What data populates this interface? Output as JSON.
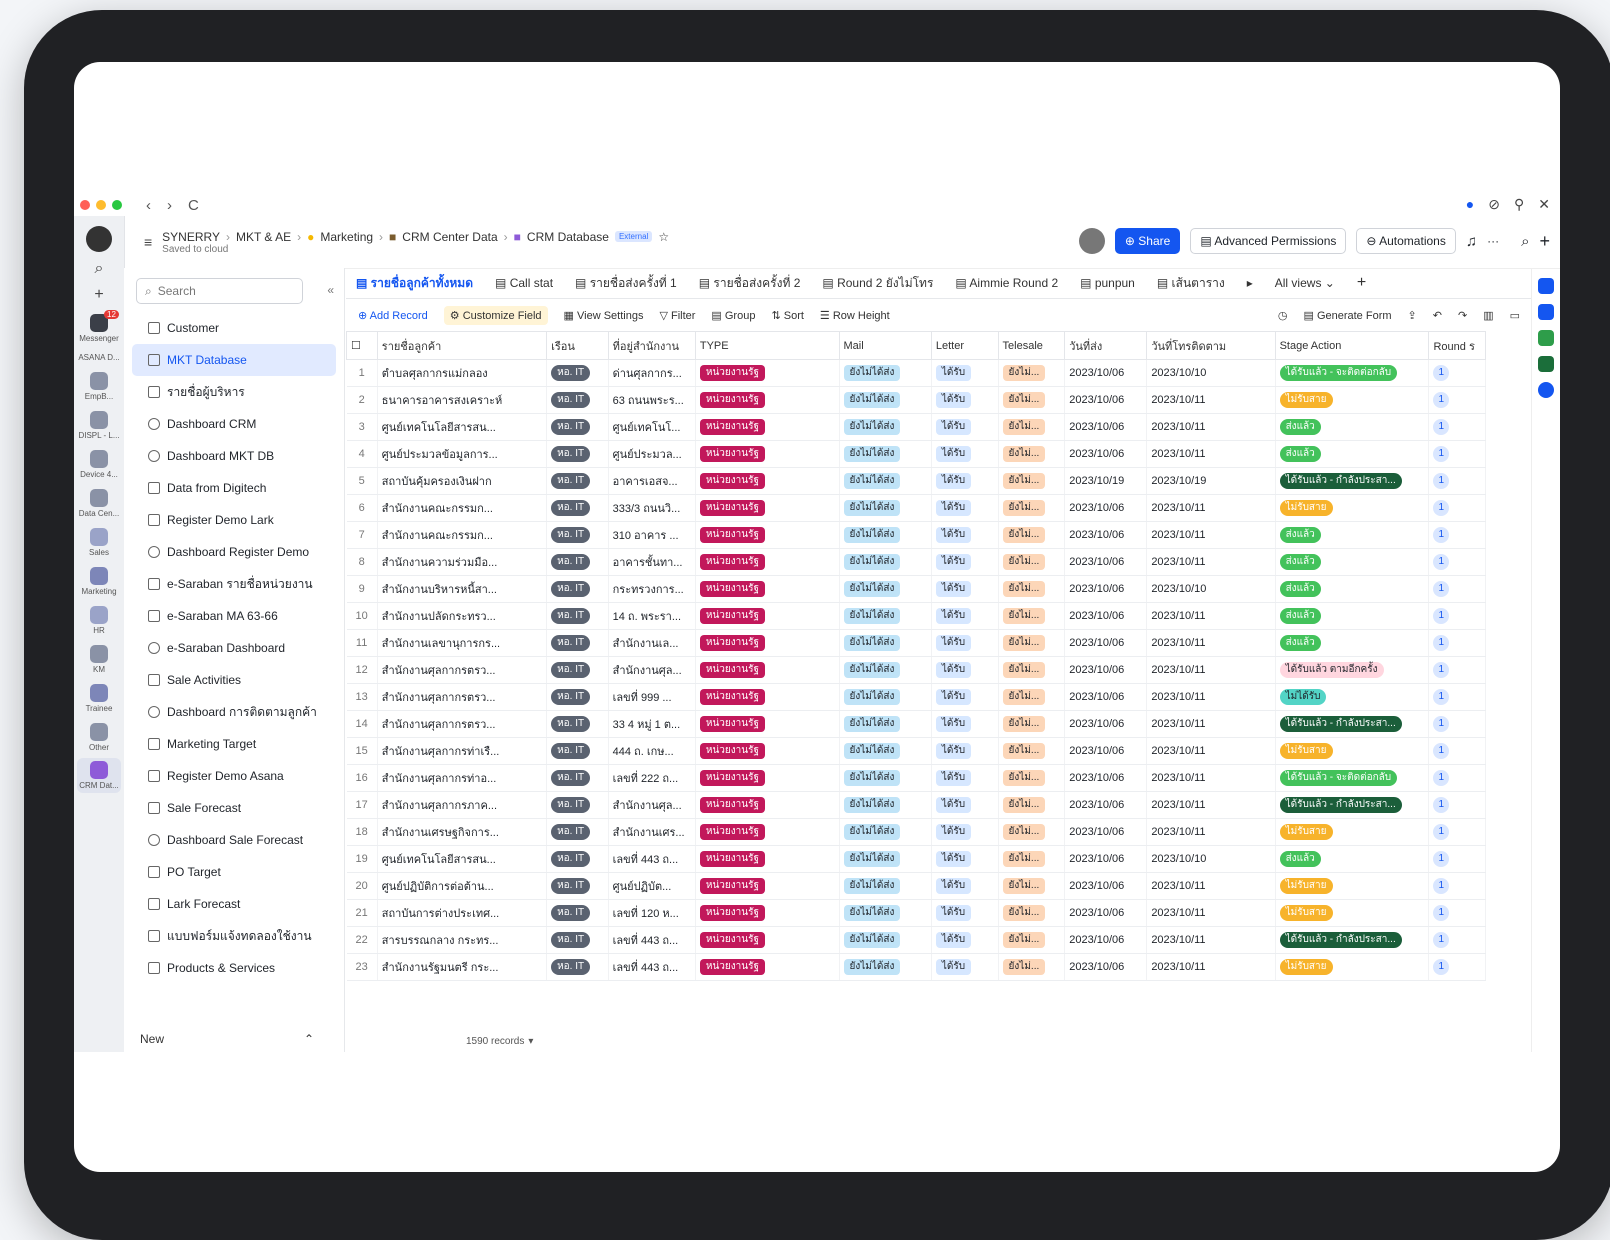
{
  "window": {
    "nav_back": "‹",
    "nav_forward": "›",
    "nav_reload": "C",
    "controls": [
      "●",
      "⊘",
      "⚲",
      "✕"
    ]
  },
  "rail": {
    "messenger_badge": "12",
    "items": [
      "Messenger",
      "ASANA D...",
      "EmpB...",
      "DISPL - L...",
      "Device 4...",
      "Data Cen...",
      "Sales",
      "Marketing",
      "HR",
      "KM",
      "Trainee",
      "Other",
      "CRM Dat..."
    ]
  },
  "header": {
    "crumbs": [
      "SYNERRY",
      "MKT & AE",
      "Marketing",
      "CRM Center Data",
      "CRM Database"
    ],
    "external": "External",
    "saved": "Saved to cloud",
    "share": "Share",
    "advanced_permissions": "Advanced Permissions",
    "automations": "Automations"
  },
  "sidebar": {
    "search_placeholder": "Search",
    "items": [
      {
        "label": "Customer",
        "type": "table"
      },
      {
        "label": "MKT Database",
        "type": "table",
        "active": true
      },
      {
        "label": "รายชื่อผู้บริหาร",
        "type": "table"
      },
      {
        "label": "Dashboard CRM",
        "type": "dash"
      },
      {
        "label": "Dashboard MKT DB",
        "type": "dash"
      },
      {
        "label": "Data from Digitech",
        "type": "table"
      },
      {
        "label": "Register Demo Lark",
        "type": "table"
      },
      {
        "label": "Dashboard Register Demo",
        "type": "dash"
      },
      {
        "label": "e-Saraban รายชื่อหน่วยงาน",
        "type": "table"
      },
      {
        "label": "e-Saraban MA 63-66",
        "type": "table"
      },
      {
        "label": "e-Saraban Dashboard",
        "type": "dash"
      },
      {
        "label": "Sale Activities",
        "type": "table"
      },
      {
        "label": "Dashboard การติดตามลูกค้า",
        "type": "dash"
      },
      {
        "label": "Marketing Target",
        "type": "table"
      },
      {
        "label": "Register Demo Asana",
        "type": "table"
      },
      {
        "label": "Sale Forecast",
        "type": "table"
      },
      {
        "label": "Dashboard Sale Forecast",
        "type": "dash"
      },
      {
        "label": "PO Target",
        "type": "table"
      },
      {
        "label": "Lark Forecast",
        "type": "table"
      },
      {
        "label": "แบบฟอร์มแจ้งทดลองใช้งาน",
        "type": "table"
      },
      {
        "label": "Products & Services",
        "type": "table"
      }
    ],
    "new_label": "New"
  },
  "views": {
    "tabs": [
      "รายชื่อลูกค้าทั้งหมด",
      "Call stat",
      "รายชื่อส่งครั้งที่ 1",
      "รายชื่อส่งครั้งที่ 2",
      "Round 2 ยังไม่โทร",
      "Aimmie Round 2",
      "punpun",
      "เส้นตาราง"
    ],
    "all_views": "All views"
  },
  "toolbar": {
    "add_record": "Add Record",
    "customize_field": "Customize Field",
    "view_settings": "View Settings",
    "filter": "Filter",
    "group": "Group",
    "sort": "Sort",
    "row_height": "Row Height",
    "generate_form": "Generate Form"
  },
  "table": {
    "columns": [
      "",
      "รายชื่อลูกค้า",
      "เรือน",
      "ที่อยู่สำนักงาน",
      "TYPE",
      "Mail",
      "Letter",
      "Telesale",
      "วันที่ส่ง",
      "วันที่โทรติดตาม",
      "Stage Action",
      "Round ร"
    ],
    "rows": [
      {
        "n": "1",
        "name": "ตำบลศุลกากรแม่กลอง",
        "ru": "หอ. IT",
        "addr": "ด่านศุลกากร...",
        "type": "หน่วยงานรัฐ",
        "mail": "ยังไม่ได้ส่ง",
        "letter": "ได้รับ",
        "tele": "ยังไม่...",
        "sent": "2023/10/06",
        "follow": "2023/10/10",
        "stage": "ได้รับแล้ว - จะติดต่อกลับ",
        "stage_c": "g1",
        "round": "1"
      },
      {
        "n": "2",
        "name": "ธนาคารอาคารสงเคราะห์",
        "ru": "หอ. IT",
        "addr": "63 ถนนพระร...",
        "type": "หน่วยงานรัฐ",
        "mail": "ยังไม่ได้ส่ง",
        "letter": "ได้รับ",
        "tele": "ยังไม่...",
        "sent": "2023/10/06",
        "follow": "2023/10/11",
        "stage": "ไม่รับสาย",
        "stage_c": "or",
        "round": "1"
      },
      {
        "n": "3",
        "name": "ศูนย์เทคโนโลยีสารสน...",
        "ru": "หอ. IT",
        "addr": "ศูนย์เทคโนโ...",
        "type": "หน่วยงานรัฐ",
        "mail": "ยังไม่ได้ส่ง",
        "letter": "ได้รับ",
        "tele": "ยังไม่...",
        "sent": "2023/10/06",
        "follow": "2023/10/11",
        "stage": "ส่งแล้ว",
        "stage_c": "g1",
        "round": "1"
      },
      {
        "n": "4",
        "name": "ศูนย์ประมวลข้อมูลการ...",
        "ru": "หอ. IT",
        "addr": "ศูนย์ประมวล...",
        "type": "หน่วยงานรัฐ",
        "mail": "ยังไม่ได้ส่ง",
        "letter": "ได้รับ",
        "tele": "ยังไม่...",
        "sent": "2023/10/06",
        "follow": "2023/10/11",
        "stage": "ส่งแล้ว",
        "stage_c": "g1",
        "round": "1"
      },
      {
        "n": "5",
        "name": "สถาบันคุ้มครองเงินฝาก",
        "ru": "หอ. IT",
        "addr": "อาคารเอสจ...",
        "type": "หน่วยงานรัฐ",
        "mail": "ยังไม่ได้ส่ง",
        "letter": "ได้รับ",
        "tele": "ยังไม่...",
        "sent": "2023/10/19",
        "follow": "2023/10/19",
        "stage": "ได้รับแล้ว - กำลังประสา...",
        "stage_c": "dg",
        "round": "1"
      },
      {
        "n": "6",
        "name": "สำนักงานคณะกรรมก...",
        "ru": "หอ. IT",
        "addr": "333/3 ถนนวิ...",
        "type": "หน่วยงานรัฐ",
        "mail": "ยังไม่ได้ส่ง",
        "letter": "ได้รับ",
        "tele": "ยังไม่...",
        "sent": "2023/10/06",
        "follow": "2023/10/11",
        "stage": "ไม่รับสาย",
        "stage_c": "or",
        "round": "1"
      },
      {
        "n": "7",
        "name": "สำนักงานคณะกรรมก...",
        "ru": "หอ. IT",
        "addr": "310 อาคาร ...",
        "type": "หน่วยงานรัฐ",
        "mail": "ยังไม่ได้ส่ง",
        "letter": "ได้รับ",
        "tele": "ยังไม่...",
        "sent": "2023/10/06",
        "follow": "2023/10/11",
        "stage": "ส่งแล้ว",
        "stage_c": "g1",
        "round": "1"
      },
      {
        "n": "8",
        "name": "สำนักงานความร่วมมือ...",
        "ru": "หอ. IT",
        "addr": "อาคารชั้นทา...",
        "type": "หน่วยงานรัฐ",
        "mail": "ยังไม่ได้ส่ง",
        "letter": "ได้รับ",
        "tele": "ยังไม่...",
        "sent": "2023/10/06",
        "follow": "2023/10/11",
        "stage": "ส่งแล้ว",
        "stage_c": "g1",
        "round": "1"
      },
      {
        "n": "9",
        "name": "สำนักงานบริหารหนี้สา...",
        "ru": "หอ. IT",
        "addr": "กระทรวงการ...",
        "type": "หน่วยงานรัฐ",
        "mail": "ยังไม่ได้ส่ง",
        "letter": "ได้รับ",
        "tele": "ยังไม่...",
        "sent": "2023/10/06",
        "follow": "2023/10/10",
        "stage": "ส่งแล้ว",
        "stage_c": "g1",
        "round": "1"
      },
      {
        "n": "10",
        "name": "สำนักงานปลัดกระทรว...",
        "ru": "หอ. IT",
        "addr": "14 ถ. พระรา...",
        "type": "หน่วยงานรัฐ",
        "mail": "ยังไม่ได้ส่ง",
        "letter": "ได้รับ",
        "tele": "ยังไม่...",
        "sent": "2023/10/06",
        "follow": "2023/10/11",
        "stage": "ส่งแล้ว",
        "stage_c": "g1",
        "round": "1"
      },
      {
        "n": "11",
        "name": "สำนักงานเลขานุการกร...",
        "ru": "หอ. IT",
        "addr": "สำนักงานเล...",
        "type": "หน่วยงานรัฐ",
        "mail": "ยังไม่ได้ส่ง",
        "letter": "ได้รับ",
        "tele": "ยังไม่...",
        "sent": "2023/10/06",
        "follow": "2023/10/11",
        "stage": "ส่งแล้ว",
        "stage_c": "g1",
        "round": "1"
      },
      {
        "n": "12",
        "name": "สำนักงานศุลกากรตรว...",
        "ru": "หอ. IT",
        "addr": "สำนักงานศุล...",
        "type": "หน่วยงานรัฐ",
        "mail": "ยังไม่ได้ส่ง",
        "letter": "ได้รับ",
        "tele": "ยังไม่...",
        "sent": "2023/10/06",
        "follow": "2023/10/11",
        "stage": "ได้รับแล้ว ตามอีกครั้ง",
        "stage_c": "pk",
        "round": "1"
      },
      {
        "n": "13",
        "name": "สำนักงานศุลกากรตรว...",
        "ru": "หอ. IT",
        "addr": "เลขที่ 999 ...",
        "type": "หน่วยงานรัฐ",
        "mail": "ยังไม่ได้ส่ง",
        "letter": "ได้รับ",
        "tele": "ยังไม่...",
        "sent": "2023/10/06",
        "follow": "2023/10/11",
        "stage": "ไม่ได้รับ",
        "stage_c": "cy",
        "round": "1"
      },
      {
        "n": "14",
        "name": "สำนักงานศุลกากรตรว...",
        "ru": "หอ. IT",
        "addr": "33 4 หมู่ 1 ต...",
        "type": "หน่วยงานรัฐ",
        "mail": "ยังไม่ได้ส่ง",
        "letter": "ได้รับ",
        "tele": "ยังไม่...",
        "sent": "2023/10/06",
        "follow": "2023/10/11",
        "stage": "ได้รับแล้ว - กำลังประสา...",
        "stage_c": "dg",
        "round": "1"
      },
      {
        "n": "15",
        "name": "สำนักงานศุลกากรท่าเรื...",
        "ru": "หอ. IT",
        "addr": "444 ถ. เกษ...",
        "type": "หน่วยงานรัฐ",
        "mail": "ยังไม่ได้ส่ง",
        "letter": "ได้รับ",
        "tele": "ยังไม่...",
        "sent": "2023/10/06",
        "follow": "2023/10/11",
        "stage": "ไม่รับสาย",
        "stage_c": "or",
        "round": "1"
      },
      {
        "n": "16",
        "name": "สำนักงานศุลกากรท่าอ...",
        "ru": "หอ. IT",
        "addr": "เลขที่ 222 ถ...",
        "type": "หน่วยงานรัฐ",
        "mail": "ยังไม่ได้ส่ง",
        "letter": "ได้รับ",
        "tele": "ยังไม่...",
        "sent": "2023/10/06",
        "follow": "2023/10/11",
        "stage": "ได้รับแล้ว - จะติดต่อกลับ",
        "stage_c": "g1",
        "round": "1"
      },
      {
        "n": "17",
        "name": "สำนักงานศุลกากรภาค...",
        "ru": "หอ. IT",
        "addr": "สำนักงานศุล...",
        "type": "หน่วยงานรัฐ",
        "mail": "ยังไม่ได้ส่ง",
        "letter": "ได้รับ",
        "tele": "ยังไม่...",
        "sent": "2023/10/06",
        "follow": "2023/10/11",
        "stage": "ได้รับแล้ว - กำลังประสา...",
        "stage_c": "dg",
        "round": "1"
      },
      {
        "n": "18",
        "name": "สำนักงานเศรษฐกิจการ...",
        "ru": "หอ. IT",
        "addr": "สำนักงานเศร...",
        "type": "หน่วยงานรัฐ",
        "mail": "ยังไม่ได้ส่ง",
        "letter": "ได้รับ",
        "tele": "ยังไม่...",
        "sent": "2023/10/06",
        "follow": "2023/10/11",
        "stage": "ไม่รับสาย",
        "stage_c": "or",
        "round": "1"
      },
      {
        "n": "19",
        "name": "ศูนย์เทคโนโลยีสารสน...",
        "ru": "หอ. IT",
        "addr": "เลขที่ 443 ถ...",
        "type": "หน่วยงานรัฐ",
        "mail": "ยังไม่ได้ส่ง",
        "letter": "ได้รับ",
        "tele": "ยังไม่...",
        "sent": "2023/10/06",
        "follow": "2023/10/10",
        "stage": "ส่งแล้ว",
        "stage_c": "g1",
        "round": "1"
      },
      {
        "n": "20",
        "name": "ศูนย์ปฏิบัติการต่อต้าน...",
        "ru": "หอ. IT",
        "addr": "ศูนย์ปฏิบัต...",
        "type": "หน่วยงานรัฐ",
        "mail": "ยังไม่ได้ส่ง",
        "letter": "ได้รับ",
        "tele": "ยังไม่...",
        "sent": "2023/10/06",
        "follow": "2023/10/11",
        "stage": "ไม่รับสาย",
        "stage_c": "or",
        "round": "1"
      },
      {
        "n": "21",
        "name": "สถาบันการต่างประเทศ...",
        "ru": "หอ. IT",
        "addr": "เลขที่ 120 ห...",
        "type": "หน่วยงานรัฐ",
        "mail": "ยังไม่ได้ส่ง",
        "letter": "ได้รับ",
        "tele": "ยังไม่...",
        "sent": "2023/10/06",
        "follow": "2023/10/11",
        "stage": "ไม่รับสาย",
        "stage_c": "or",
        "round": "1"
      },
      {
        "n": "22",
        "name": "สารบรรณกลาง กระทร...",
        "ru": "หอ. IT",
        "addr": "เลขที่ 443 ถ...",
        "type": "หน่วยงานรัฐ",
        "mail": "ยังไม่ได้ส่ง",
        "letter": "ได้รับ",
        "tele": "ยังไม่...",
        "sent": "2023/10/06",
        "follow": "2023/10/11",
        "stage": "ได้รับแล้ว - กำลังประสา...",
        "stage_c": "dg",
        "round": "1"
      },
      {
        "n": "23",
        "name": "สำนักงานรัฐมนตรี กระ...",
        "ru": "หอ. IT",
        "addr": "เลขที่ 443 ถ...",
        "type": "หน่วยงานรัฐ",
        "mail": "ยังไม่ได้ส่ง",
        "letter": "ได้รับ",
        "tele": "ยังไม่...",
        "sent": "2023/10/06",
        "follow": "2023/10/11",
        "stage": "ไม่รับสาย",
        "stage_c": "or",
        "round": "1"
      }
    ]
  },
  "footer": {
    "records": "1590 records"
  }
}
